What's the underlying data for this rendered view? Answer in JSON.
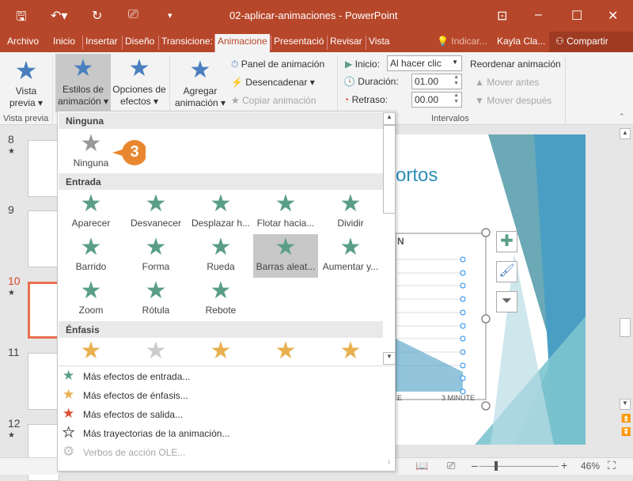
{
  "title": "02-aplicar-animaciones  -  PowerPoint",
  "tabs": [
    "Archivo",
    "Inicio",
    "Insertar",
    "Diseño",
    "Transicione:",
    "Animacione",
    "Presentació",
    "Revisar",
    "Vista"
  ],
  "tell_me": "Indicar...",
  "user": "Kayla Cla...",
  "share": "Compartir",
  "ribbon": {
    "preview_l1": "Vista",
    "preview_l2": "previa",
    "styles_l1": "Estilos de",
    "styles_l2": "animación",
    "options_l1": "Opciones de",
    "options_l2": "efectos",
    "add_l1": "Agregar",
    "add_l2": "animación",
    "panel": "Panel de animación",
    "trigger": "Desencadenar",
    "copy": "Copiar animación",
    "start_label": "Inicio:",
    "start_value": "Al hacer clic",
    "duration_label": "Duración:",
    "duration_value": "01.00",
    "delay_label": "Retraso:",
    "delay_value": "00.00",
    "reorder": "Reordenar animación",
    "move_before": "Mover antes",
    "move_after": "Mover después",
    "group_preview": "Vista previa",
    "group_timing": "Intervalos"
  },
  "slides": [
    {
      "num": "8"
    },
    {
      "num": "9"
    },
    {
      "num": "10",
      "selected": true
    },
    {
      "num": "11"
    },
    {
      "num": "12"
    }
  ],
  "gallery": {
    "none_header": "Ninguna",
    "none_item": "Ninguna",
    "entrance_header": "Entrada",
    "entrance": [
      "Aparecer",
      "Desvanecer",
      "Desplazar h...",
      "Flotar hacia...",
      "Dividir",
      "Barrido",
      "Forma",
      "Rueda",
      "Barras aleat...",
      "Aumentar y...",
      "Zoom",
      "Rótula",
      "Rebote"
    ],
    "selected": "Barras aleat...",
    "emphasis_header": "Énfasis",
    "entrance_color": "#5a9e87",
    "emphasis_color": "#e8b04f",
    "exit_color": "#d9502f"
  },
  "menu": [
    "Más efectos de entrada...",
    "Más efectos de énfasis...",
    "Más efectos de salida...",
    "Más trayectorias de la animación...",
    "Verbos de acción OLE..."
  ],
  "callout": "3",
  "slide": {
    "title_fragment": "ortos",
    "axis_label": "3 MINUTE",
    "axis_label_left": "E",
    "chart_letter": "N"
  },
  "zoom": "46%"
}
